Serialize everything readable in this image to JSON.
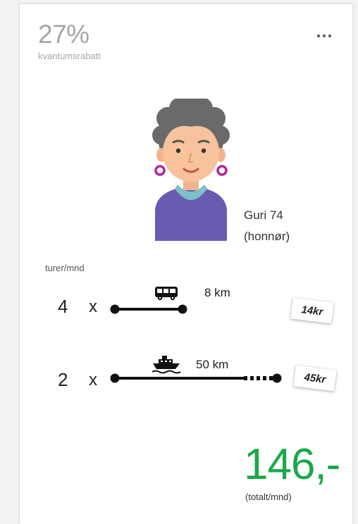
{
  "discount": {
    "percent": "27%",
    "label": "kvantumsrabatt"
  },
  "menu": {
    "icon": "more-horizontal-icon"
  },
  "person": {
    "name": "Guri 74",
    "type": "(honnør)",
    "avatar_icon": "elderly-woman-avatar-icon"
  },
  "trips": {
    "header": "turer/mnd",
    "multiplier": "x",
    "routes": [
      {
        "count": "4",
        "mode_icon": "bus-icon",
        "distance": "8 km",
        "price": "14kr"
      },
      {
        "count": "2",
        "mode_icon": "ferry-icon",
        "distance": "50 km",
        "price": "45kr"
      }
    ]
  },
  "total": {
    "amount": "146,-",
    "label": "(totalt/mnd)"
  },
  "colors": {
    "total_green": "#1aa84a",
    "muted_gray": "#a6a6a6",
    "sweater_purple": "#6b5bb0",
    "earring_magenta": "#b0289a"
  }
}
